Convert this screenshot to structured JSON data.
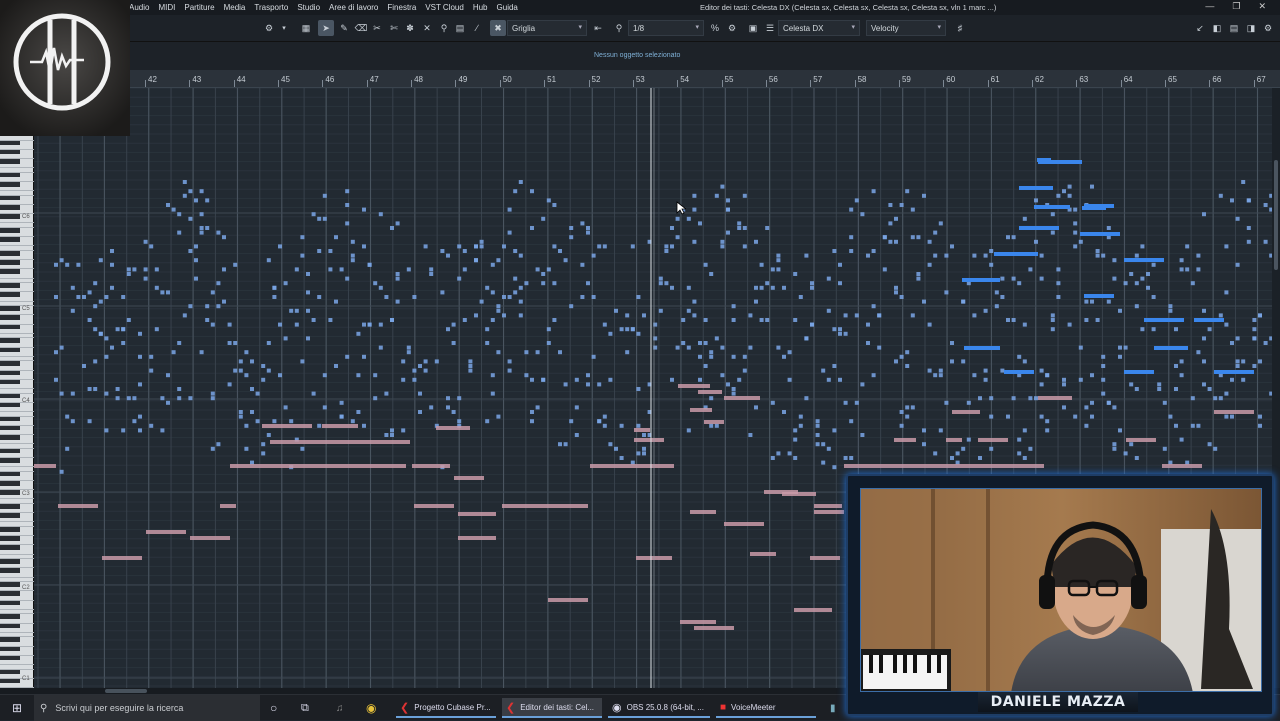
{
  "menubar": {
    "items": [
      "Audio",
      "MIDI",
      "Partiture",
      "Media",
      "Trasporto",
      "Studio",
      "Aree di lavoro",
      "Finestra",
      "VST Cloud",
      "Hub",
      "Guida"
    ],
    "window_title": "Editor dei tasti: Celesta DX (Celesta sx, Celesta sx, Celesta sx, Celesta sx, vln 1 marc ...)"
  },
  "toolbar": {
    "snap_mode": "Griglia",
    "quantize": "1/8",
    "track": "Celesta DX",
    "controller": "Velocity"
  },
  "info": {
    "selection_status": "Nessun oggetto selezionato"
  },
  "ruler": {
    "bars": [
      "42",
      "43",
      "44",
      "45",
      "46",
      "47",
      "48",
      "49",
      "50",
      "51",
      "52",
      "53",
      "54",
      "55",
      "56",
      "57",
      "58",
      "59",
      "60",
      "61",
      "62",
      "63",
      "64",
      "65",
      "66",
      "67"
    ]
  },
  "keyboard": {
    "labels": [
      "C6",
      "C5",
      "C4",
      "C3",
      "C2",
      "C1"
    ]
  },
  "colors": {
    "note_blue": "#7aa6e6",
    "note_bright_blue": "#3a86ec",
    "note_pink": "#c99aa8",
    "grid_bg": "#222a32",
    "accent": "#1f6fd6"
  },
  "taskbar": {
    "search_placeholder": "Scrivi qui per eseguire la ricerca",
    "apps": [
      {
        "label": "Progetto Cubase Pr..."
      },
      {
        "label": "Editor dei tasti: Cel..."
      },
      {
        "label": "OBS 25.0.8 (64-bit, ..."
      },
      {
        "label": "VoiceMeeter"
      }
    ]
  },
  "webcam": {
    "name": "DANIELE MAZZA"
  }
}
